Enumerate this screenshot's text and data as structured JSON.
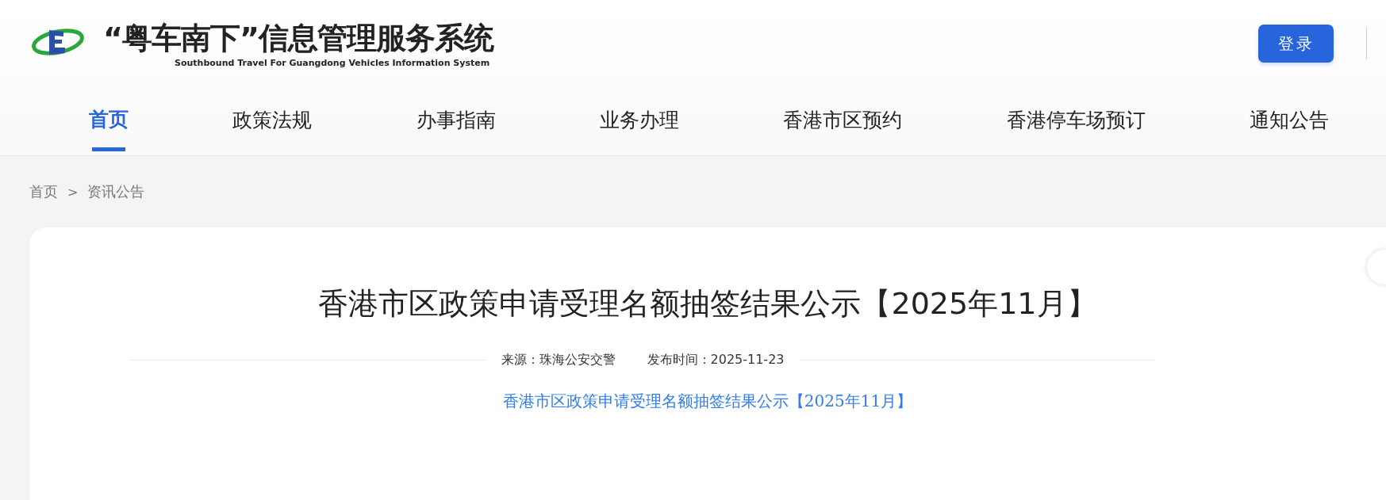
{
  "header": {
    "title": "“粤车南下”信息管理服务系统",
    "subtitle": "Southbound Travel For Guangdong Vehicles Information System",
    "login_button": "登录"
  },
  "nav": [
    {
      "label": "首页",
      "selected": true
    },
    {
      "label": "政策法规",
      "selected": false
    },
    {
      "label": "办事指南",
      "selected": false
    },
    {
      "label": "业务办理",
      "selected": false
    },
    {
      "label": "香港市区预约",
      "selected": false
    },
    {
      "label": "香港停车场预订",
      "selected": false
    },
    {
      "label": "通知公告",
      "selected": false
    }
  ],
  "breadcrumb": {
    "items": [
      "首页",
      "资讯公告"
    ],
    "separator": ">"
  },
  "article": {
    "title": "香港市区政策申请受理名额抽签结果公示【2025年11月】",
    "source": "来源：珠海公安交警",
    "published": "发布时间：2025-11-23",
    "attachment_link": "香港市区政策申请受理名额抽签结果公示【2025年11月】"
  }
}
